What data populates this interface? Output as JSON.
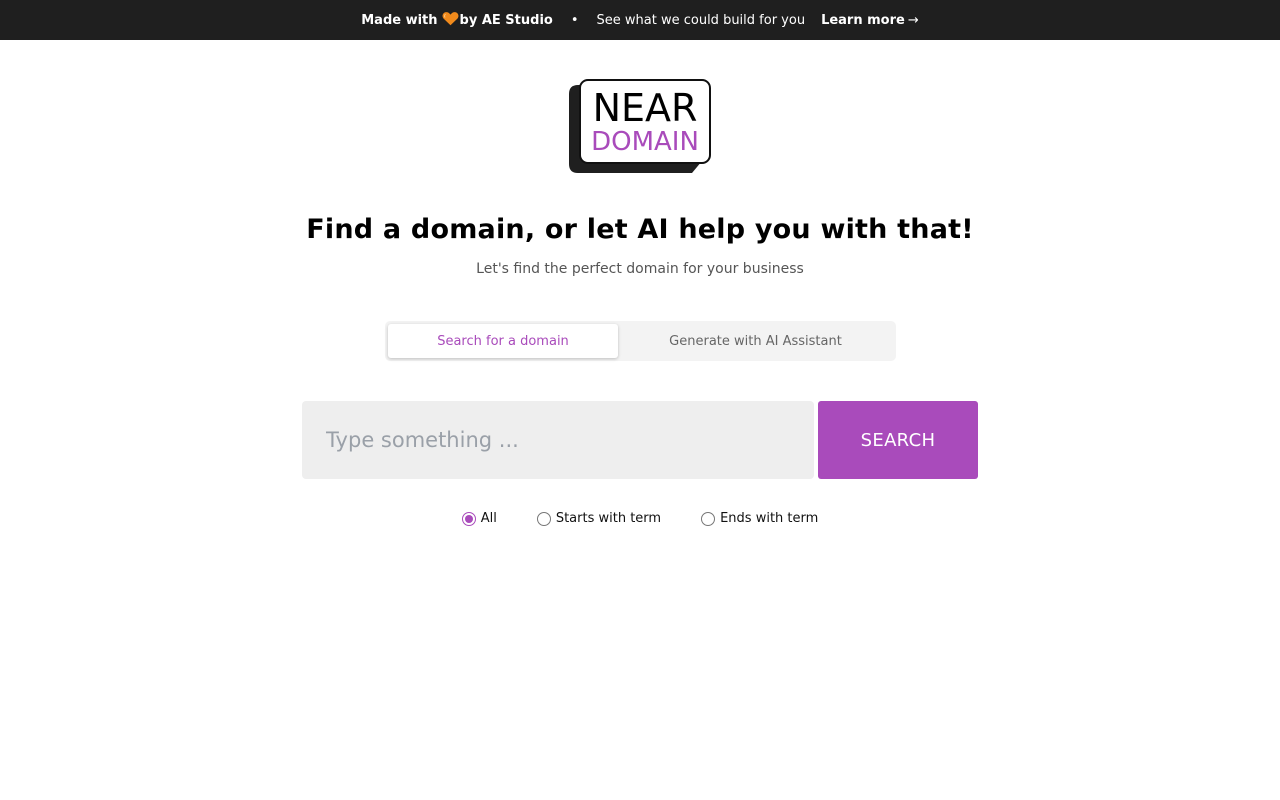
{
  "banner": {
    "made_with": "Made with",
    "heart_icon": "orange-heart-icon",
    "by": "by AE Studio",
    "dot": "•",
    "see": "See what we could build for you",
    "learn_more": "Learn more",
    "arrow": "→",
    "bg_color": "#1f1f1f"
  },
  "logo": {
    "line1": "NEAR",
    "line2": "DOMAIN",
    "accent": "#a94bbb"
  },
  "hero": {
    "headline": "Find a domain, or let AI help you with that!",
    "subline": "Let's find the perfect domain for your business"
  },
  "tabs": [
    {
      "label": "Search for a domain",
      "active": true
    },
    {
      "label": "Generate with AI Assistant",
      "active": false
    }
  ],
  "search": {
    "placeholder": "Type something ...",
    "value": "",
    "button_label": "SEARCH",
    "accent": "#a94bbb"
  },
  "filters": [
    {
      "label": "All",
      "checked": true
    },
    {
      "label": "Starts with term",
      "checked": false
    },
    {
      "label": "Ends with term",
      "checked": false
    }
  ]
}
